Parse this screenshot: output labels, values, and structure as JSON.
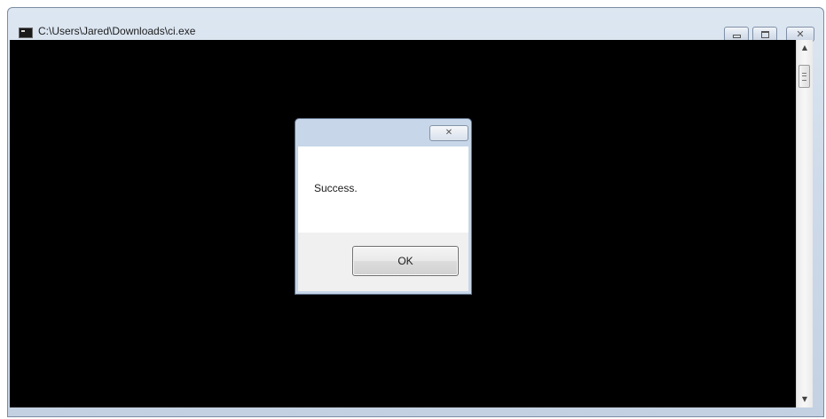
{
  "window": {
    "title": "C:\\Users\\Jared\\Downloads\\ci.exe",
    "icon": "console-app-icon",
    "controls": {
      "minimize_icon": "minimize-icon",
      "maximize_icon": "maximize-icon",
      "close_glyph": "✕"
    },
    "console_background": "#000000"
  },
  "scrollbar": {
    "up_glyph": "▲",
    "down_glyph": "▼"
  },
  "dialog": {
    "close_glyph": "✕",
    "message": "Success.",
    "ok_label": "OK"
  }
}
